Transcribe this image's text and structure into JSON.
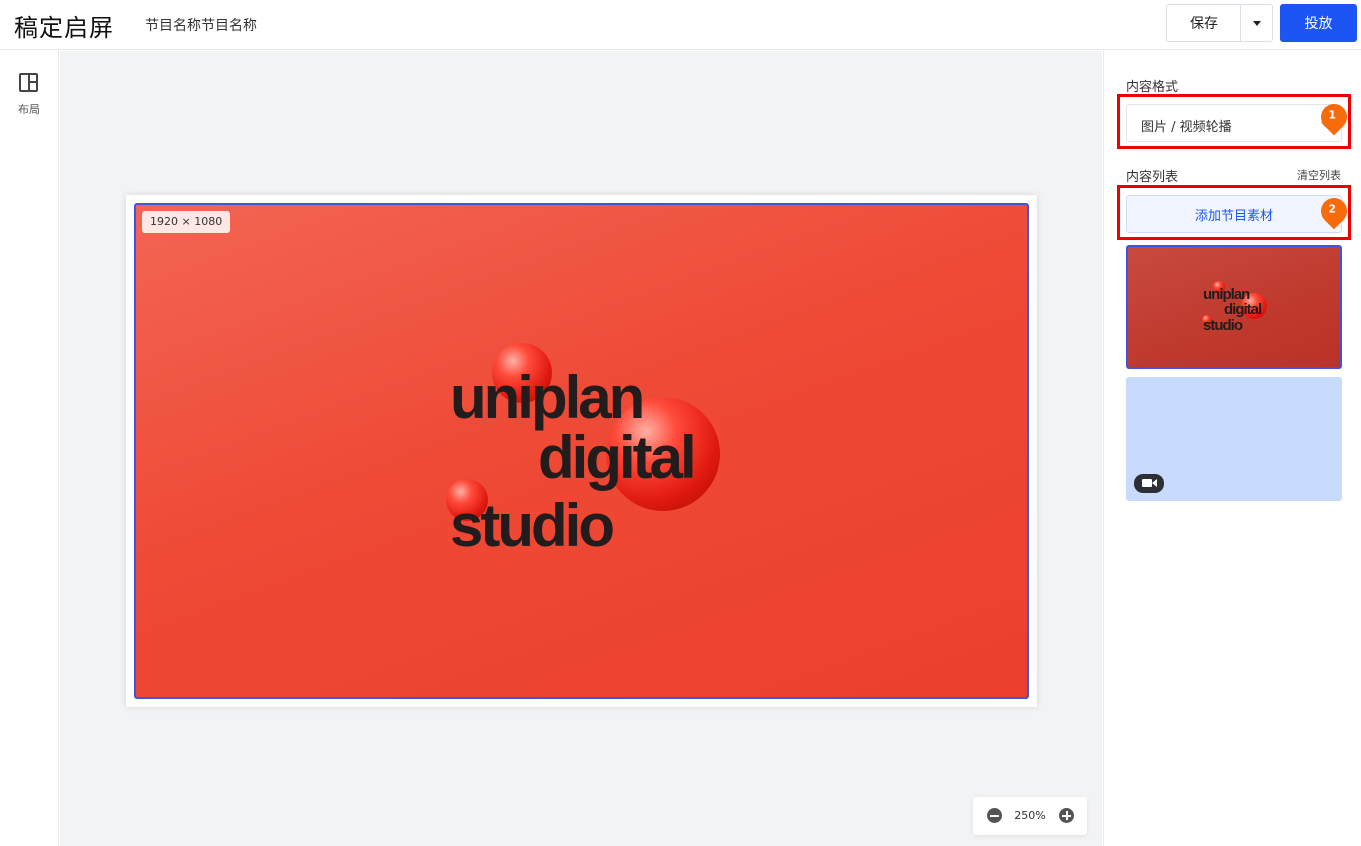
{
  "header": {
    "app_title": "稿定启屏",
    "program_name": "节目名称节目名称",
    "save_label": "保存",
    "publish_label": "投放"
  },
  "sidebar": {
    "items": [
      {
        "label": "布局",
        "icon": "layout-icon"
      }
    ]
  },
  "canvas": {
    "resolution_label": "1920 × 1080",
    "slide_text": {
      "line1": "uniplan",
      "line2": "digital",
      "line3": "studio"
    },
    "zoom_label": "250%"
  },
  "panel": {
    "format_label": "内容格式",
    "format_value": "图片 / 视频轮播",
    "list_label": "内容列表",
    "clear_label": "清空列表",
    "add_label": "添加节目素材",
    "markers": [
      "1",
      "2"
    ],
    "items": [
      {
        "type": "image",
        "text": {
          "line1": "uniplan",
          "line2": "digital",
          "line3": "studio"
        }
      },
      {
        "type": "video",
        "icon": "video-camera-icon"
      }
    ]
  },
  "colors": {
    "accent": "#1d55f5",
    "selection": "#3d55e0",
    "annotation_box": "#ee0000",
    "marker": "#f76b0b",
    "slide_bg": "#ee4a36"
  }
}
